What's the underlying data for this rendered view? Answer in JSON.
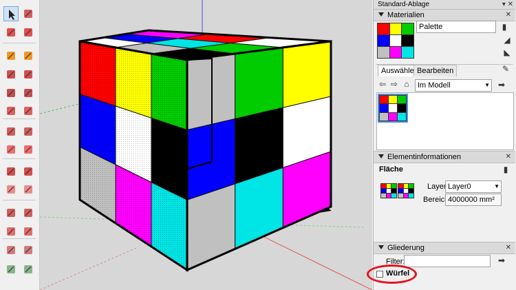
{
  "tray": {
    "title": "Standard-Ablage",
    "pin_label": "▾ ✕"
  },
  "materials": {
    "title": "Materialien",
    "name_value": "Palette",
    "tab_select": "Auswählen",
    "tab_edit": "Bearbeiten",
    "location_value": "Im Modell",
    "swatch_colors": [
      "#ff0000",
      "#ffff00",
      "#00cc00",
      "#0000ff",
      "#ffffff",
      "#000000",
      "#c0c0c0",
      "#ff00ff",
      "#00e5e5"
    ]
  },
  "entity_info": {
    "title": "Elementinformationen",
    "type_label": "Fläche",
    "layer_label": "Layer:",
    "layer_value": "Layer0",
    "area_label": "Bereich:",
    "area_value": "4000000 mm²"
  },
  "outliner": {
    "title": "Gliederung",
    "filter_label": "Filter:",
    "filter_value": "",
    "item_label": "Würfel"
  },
  "colors": {
    "red": "#ff0000",
    "yellow": "#ffff00",
    "green": "#00cc00",
    "blue": "#0000ff",
    "white": "#ffffff",
    "black": "#000000",
    "gray": "#c0c0c0",
    "magenta": "#ff00ff",
    "cyan": "#00e5e5",
    "highlight": "#e3121b",
    "viewport_bg": "#d7d7d7"
  },
  "tool_icons": [
    "select-icon",
    "make-component-icon",
    "paint-bucket-icon",
    "eraser-icon",
    "pencil-icon",
    "freehand-icon",
    "rectangle-icon",
    "rotated-rectangle-icon",
    "circle-icon",
    "polygon-icon",
    "arc-icon",
    "pie-icon",
    "two-point-arc-icon",
    "three-point-arc-icon",
    "move-icon",
    "push-pull-icon",
    "rotate-icon",
    "follow-me-icon",
    "scale-icon",
    "offset-icon",
    "tape-measure-icon",
    "dimension-icon",
    "protractor-icon",
    "text-icon",
    "axes-icon",
    "3d-text-icon",
    "section-plane-icon",
    "walk-icon"
  ]
}
